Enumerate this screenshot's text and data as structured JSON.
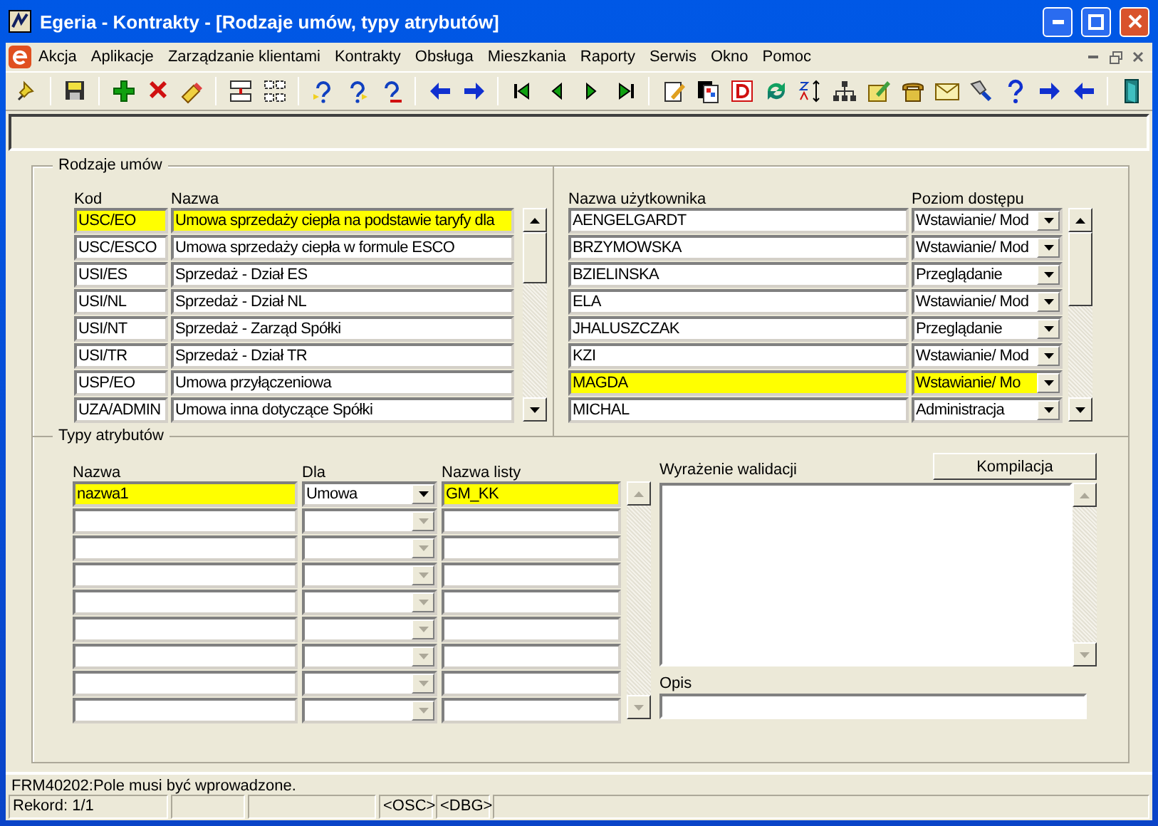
{
  "window": {
    "title": "Egeria - Kontrakty - [Rodzaje umów, typy atrybutów]"
  },
  "menu": [
    "Akcja",
    "Aplikacje",
    "Zarządzanie klientami",
    "Kontrakty",
    "Obsługa",
    "Mieszkania",
    "Raporty",
    "Serwis",
    "Okno",
    "Pomoc"
  ],
  "contract_types": {
    "title": "Rodzaje umów",
    "columns": [
      "Kod",
      "Nazwa"
    ],
    "rows": [
      {
        "code": "USC/EO",
        "name": "Umowa sprzedaży ciepła na podstawie taryfy dla",
        "selected": true
      },
      {
        "code": "USC/ESCO",
        "name": "Umowa sprzedaży ciepła w formule ESCO",
        "selected": false
      },
      {
        "code": "USI/ES",
        "name": "Sprzedaż - Dział ES",
        "selected": false
      },
      {
        "code": "USI/NL",
        "name": "Sprzedaż - Dział NL",
        "selected": false
      },
      {
        "code": "USI/NT",
        "name": "Sprzedaż - Zarząd Spółki",
        "selected": false
      },
      {
        "code": "USI/TR",
        "name": "Sprzedaż - Dział TR",
        "selected": false
      },
      {
        "code": "USP/EO",
        "name": "Umowa przyłączeniowa",
        "selected": false
      },
      {
        "code": "UZA/ADMIN",
        "name": "Umowa inna dotyczące Spółki",
        "selected": false
      }
    ]
  },
  "users": {
    "columns": [
      "Nazwa użytkownika",
      "Poziom dostępu"
    ],
    "rows": [
      {
        "user": "AENGELGARDT",
        "access": "Wstawianie/ Mod",
        "selected": false
      },
      {
        "user": "BRZYMOWSKA",
        "access": "Wstawianie/ Mod",
        "selected": false
      },
      {
        "user": "BZIELINSKA",
        "access": "Przeglądanie",
        "selected": false
      },
      {
        "user": "ELA",
        "access": "Wstawianie/ Mod",
        "selected": false
      },
      {
        "user": "JHALUSZCZAK",
        "access": "Przeglądanie",
        "selected": false
      },
      {
        "user": "KZI",
        "access": "Wstawianie/ Mod",
        "selected": false
      },
      {
        "user": "MAGDA",
        "access": "Wstawianie/ Mo",
        "selected": true
      },
      {
        "user": "MICHAL",
        "access": "Administracja",
        "selected": false
      }
    ]
  },
  "attribute_types": {
    "title": "Typy atrybutów",
    "columns": [
      "Nazwa",
      "Dla",
      "Nazwa listy"
    ],
    "rows": [
      {
        "name": "nazwa1",
        "for": "Umowa",
        "list": "GM_KK",
        "selected": true
      }
    ]
  },
  "validation": {
    "label": "Wyrażenie walidacji",
    "button": "Kompilacja",
    "description_label": "Opis"
  },
  "message": "FRM40202:Pole musi być wprowadzone.",
  "status_bar": {
    "record": "Rekord: 1/1",
    "osc": "<OSC>",
    "dbg": "<DBG>"
  }
}
